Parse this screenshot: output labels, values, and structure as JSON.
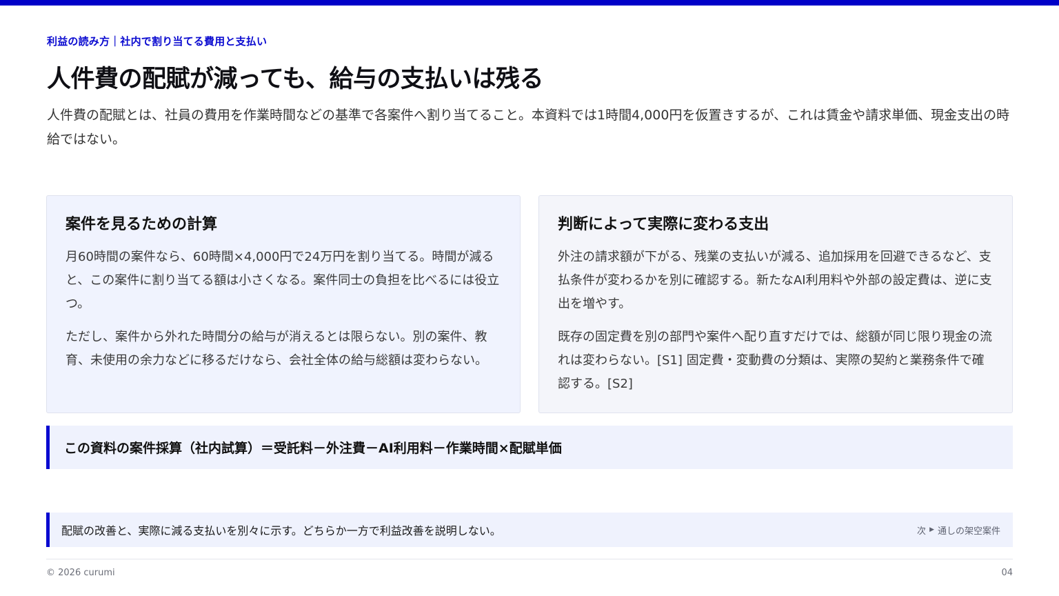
{
  "header": {
    "eyebrow": "利益の読み方｜社内で割り当てる費用と支払い",
    "title": "人件費の配賦が減っても、給与の支払いは残る",
    "lead": "人件費の配賦とは、社員の費用を作業時間などの基準で各案件へ割り当てること。本資料では1時間4,000円を仮置きするが、これは賃金や請求単価、現金支出の時給ではない。"
  },
  "cards": [
    {
      "title": "案件を見るための計算",
      "paragraphs": [
        "月60時間の案件なら、60時間×4,000円で24万円を割り当てる。時間が減ると、この案件に割り当てる額は小さくなる。案件同士の負担を比べるには役立つ。",
        "ただし、案件から外れた時間分の給与が消えるとは限らない。別の案件、教育、未使用の余力などに移るだけなら、会社全体の給与総額は変わらない。"
      ]
    },
    {
      "title": "判断によって実際に変わる支出",
      "paragraphs": [
        "外注の請求額が下がる、残業の支払いが減る、追加採用を回避できるなど、支払条件が変わるかを別に確認する。新たなAI利用料や外部の設定費は、逆に支出を増やす。",
        "既存の固定費を別の部門や案件へ配り直すだけでは、総額が同じ限り現金の流れは変わらない。[S1] 固定費・変動費の分類は、実際の契約と業務条件で確認する。[S2]"
      ]
    }
  ],
  "formula": "この資料の案件採算（社内試算）＝受託料－外注費－AI利用料－作業時間×配賦単価",
  "note": {
    "text": "配賦の改善と、実際に減る支払いを別々に示す。どちらか一方で利益改善を説明しない。",
    "next_label": "次",
    "next_target": "通しの架空案件"
  },
  "footer": {
    "copyright": "© 2026 curumi",
    "page_number": "04"
  },
  "colors": {
    "accent": "#0a0ad0",
    "card_left_bg": "#f0f3fe",
    "card_right_bg": "#f4f5fa"
  }
}
